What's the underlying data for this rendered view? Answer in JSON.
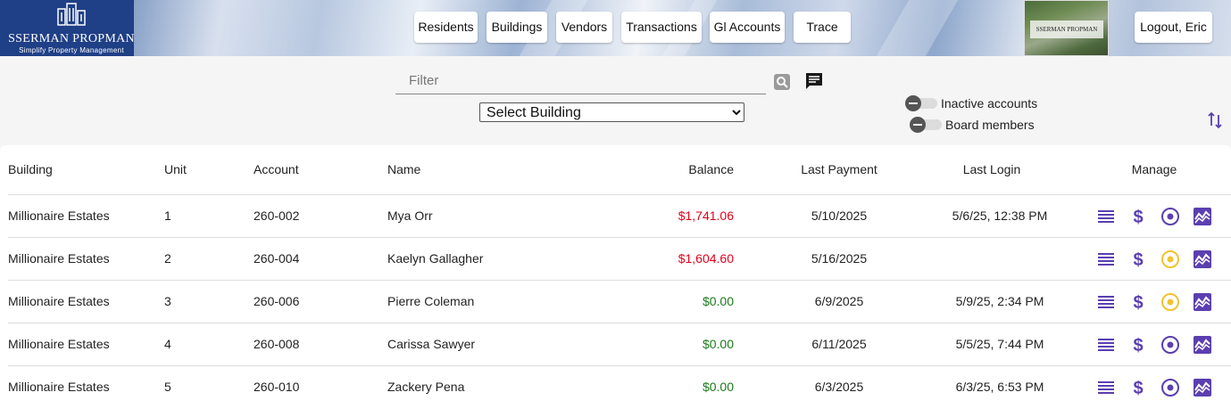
{
  "brand": {
    "name": "SSERMAN PROPMAN",
    "tagline": "Simplify Property Management",
    "photo_label": "SSERMAN PROPMAN"
  },
  "nav": {
    "residents": "Residents",
    "buildings": "Buildings",
    "vendors": "Vendors",
    "transactions": "Transactions",
    "gl_accounts": "Gl Accounts",
    "trace": "Trace",
    "logout": "Logout, Eric"
  },
  "toolbar": {
    "filter_placeholder": "Filter",
    "filter_value": "",
    "building_select": "Select Building",
    "toggle_inactive": "Inactive accounts",
    "toggle_board": "Board members",
    "toggle_inactive_on": false,
    "toggle_board_on": false
  },
  "table": {
    "headers": {
      "building": "Building",
      "unit": "Unit",
      "account": "Account",
      "name": "Name",
      "balance": "Balance",
      "last_payment": "Last Payment",
      "last_login": "Last Login",
      "manage": "Manage"
    },
    "rows": [
      {
        "building": "Millionaire Estates",
        "unit": "1",
        "account": "260-002",
        "name": "Mya Orr",
        "balance": "$1,741.06",
        "balance_status": "negative",
        "last_payment": "5/10/2025",
        "last_login": "5/6/25, 12:38 PM",
        "status_color": "#5b3fb0"
      },
      {
        "building": "Millionaire Estates",
        "unit": "2",
        "account": "260-004",
        "name": "Kaelyn Gallagher",
        "balance": "$1,604.60",
        "balance_status": "negative",
        "last_payment": "5/16/2025",
        "last_login": "",
        "status_color": "#f2c230"
      },
      {
        "building": "Millionaire Estates",
        "unit": "3",
        "account": "260-006",
        "name": "Pierre Coleman",
        "balance": "$0.00",
        "balance_status": "positive",
        "last_payment": "6/9/2025",
        "last_login": "5/9/25, 2:34 PM",
        "status_color": "#f2c230"
      },
      {
        "building": "Millionaire Estates",
        "unit": "4",
        "account": "260-008",
        "name": "Carissa Sawyer",
        "balance": "$0.00",
        "balance_status": "positive",
        "last_payment": "6/11/2025",
        "last_login": "5/5/25, 7:44 PM",
        "status_color": "#5b3fb0"
      },
      {
        "building": "Millionaire Estates",
        "unit": "5",
        "account": "260-010",
        "name": "Zackery Pena",
        "balance": "$0.00",
        "balance_status": "positive",
        "last_payment": "6/3/2025",
        "last_login": "6/3/25, 6:53 PM",
        "status_color": "#5b3fb0"
      }
    ]
  },
  "colors": {
    "accent": "#5b3fb0",
    "negative": "#e0001a",
    "positive": "#1a7a1a",
    "warning": "#f2c230"
  },
  "icons": [
    "buildings-logo-icon",
    "search-icon",
    "chat-icon",
    "sort-icon",
    "ledger-icon",
    "dollar-icon",
    "status-icon",
    "chart-icon"
  ]
}
